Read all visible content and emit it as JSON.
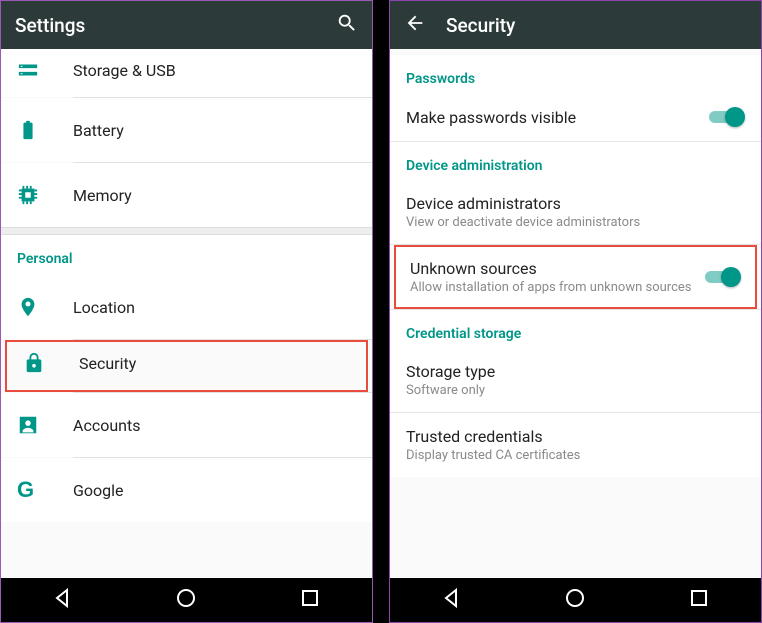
{
  "left": {
    "appbar": {
      "title": "Settings"
    },
    "items": {
      "storage": "Storage & USB",
      "battery": "Battery",
      "memory": "Memory",
      "location": "Location",
      "security": "Security",
      "accounts": "Accounts",
      "google": "Google"
    },
    "category_personal": "Personal"
  },
  "right": {
    "appbar": {
      "title": "Security"
    },
    "sections": {
      "passwords": "Passwords",
      "device_admin": "Device administration",
      "cred_storage": "Credential storage"
    },
    "rows": {
      "make_pw_visible": "Make passwords visible",
      "device_admins": {
        "title": "Device administrators",
        "sub": "View or deactivate device administrators"
      },
      "unknown_sources": {
        "title": "Unknown sources",
        "sub": "Allow installation of apps from unknown sources"
      },
      "storage_type": {
        "title": "Storage type",
        "sub": "Software only"
      },
      "trusted_creds": {
        "title": "Trusted credentials",
        "sub": "Display trusted CA certificates"
      }
    }
  }
}
